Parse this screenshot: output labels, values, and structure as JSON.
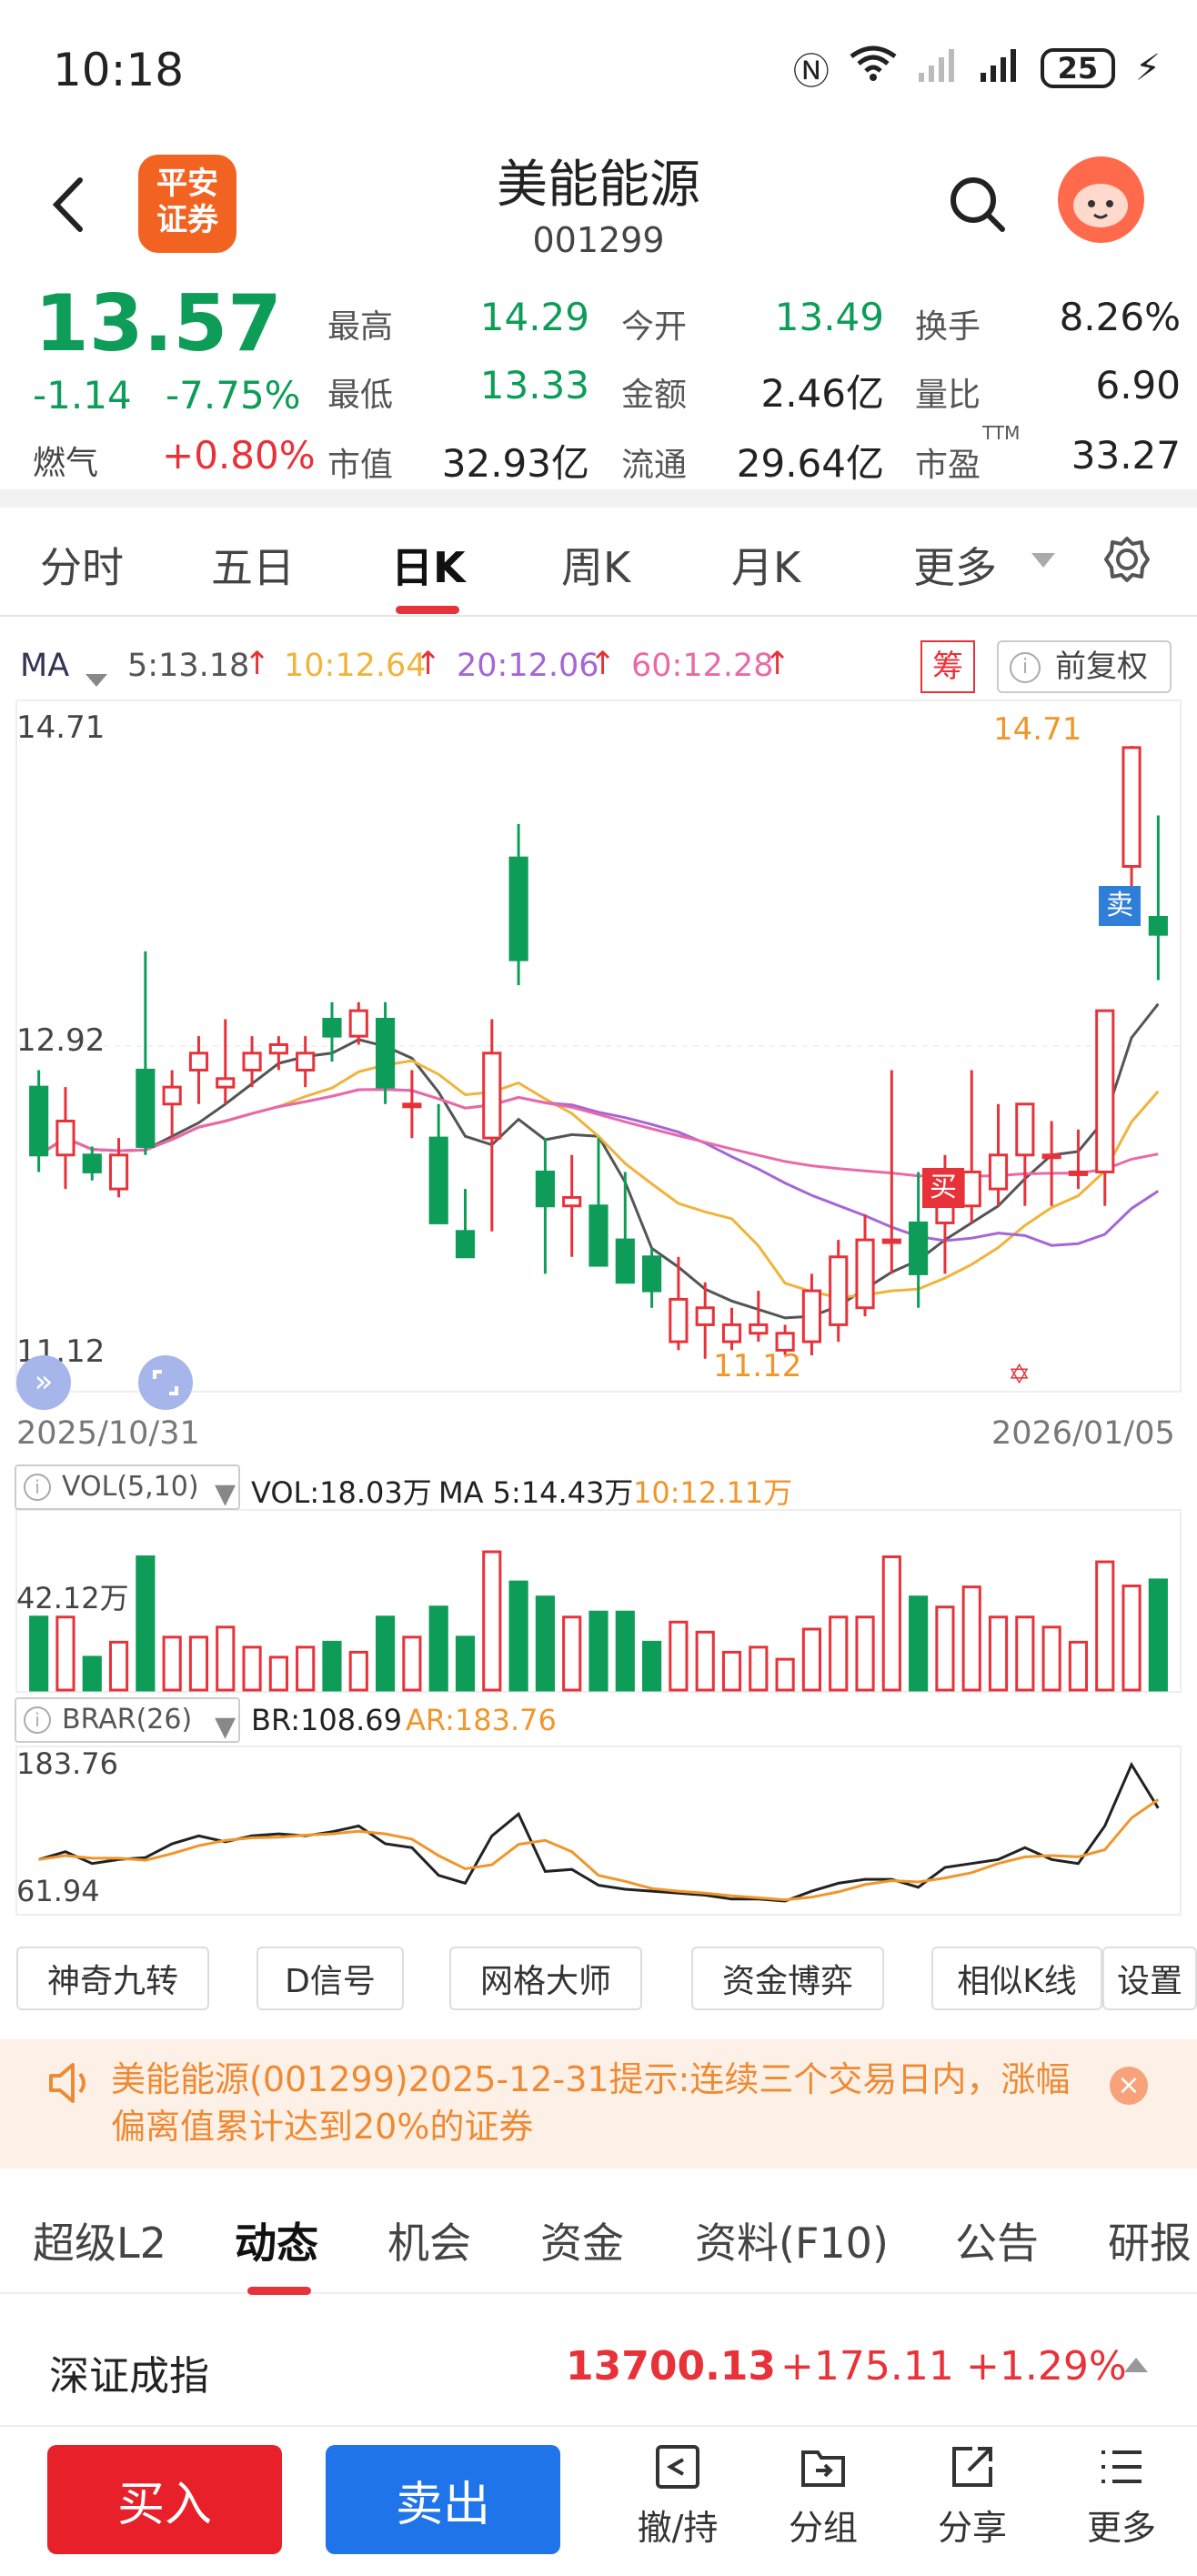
{
  "status_bar": {
    "time": "10:18",
    "battery": "25"
  },
  "header": {
    "logo_text": "平安\n证券",
    "name": "美能能源",
    "code": "001299"
  },
  "quote": {
    "price": "13.57",
    "change": "-1.14",
    "change_pct": "-7.75%",
    "sector_name": "燃气",
    "sector_change": "+0.80%",
    "high_label": "最高",
    "high": "14.29",
    "low_label": "最低",
    "low": "13.33",
    "cap_label": "市值",
    "cap": "32.93亿",
    "open_label": "今开",
    "open": "13.49",
    "amount_label": "金额",
    "amount": "2.46亿",
    "float_label": "流通",
    "float": "29.64亿",
    "turnover_label": "换手",
    "turnover": "8.26%",
    "vol_ratio_label": "量比",
    "vol_ratio": "6.90",
    "pe_label": "市盈",
    "pe_sup": "TTM",
    "pe": "33.27"
  },
  "period_tabs": [
    "分时",
    "五日",
    "日K",
    "周K",
    "月K",
    "更多"
  ],
  "ma": {
    "label": "MA",
    "ma5": "5:13.18",
    "ma10": "10:12.64",
    "ma20": "20:12.06",
    "ma60": "60:12.28",
    "chip_label": "筹",
    "adjust_label": "前复权"
  },
  "chart_labels": {
    "price_high": "14.71",
    "price_mid": "12.92",
    "price_low": "11.12",
    "max_marker": "14.71",
    "min_marker": "11.12",
    "date_start": "2025/10/31",
    "date_end": "2026/01/05",
    "sell_marker": "卖",
    "buy_marker": "买",
    "vol_indicator": "VOL(5,10)",
    "vol_value": "VOL:18.03万",
    "vol_ma5": "MA 5:14.43万",
    "vol_ma10": "10:12.11万",
    "vol_axis": "42.12万",
    "brar_indicator": "BRAR(26)",
    "br_value": "BR:108.69",
    "ar_value": "AR:183.76",
    "brar_top": "183.76",
    "brar_bottom": "61.94"
  },
  "colors": {
    "up": "#e8323a",
    "down": "#0e9d58",
    "ma5": "#555555",
    "ma10": "#f0b43a",
    "ma20": "#a566d6",
    "ma60": "#e86aa8",
    "vol_ma10": "#f0962a"
  },
  "chart_data": {
    "type": "candlestick",
    "x": [
      "2025/10/31",
      "2026/01/05"
    ],
    "ohlc": [
      [
        12.7,
        12.8,
        12.2,
        12.3
      ],
      [
        12.3,
        12.7,
        12.1,
        12.5
      ],
      [
        12.3,
        12.35,
        12.15,
        12.2
      ],
      [
        12.1,
        12.4,
        12.05,
        12.3
      ],
      [
        12.8,
        13.5,
        12.3,
        12.35
      ],
      [
        12.6,
        12.8,
        12.4,
        12.7
      ],
      [
        12.8,
        13.0,
        12.6,
        12.9
      ],
      [
        12.7,
        13.1,
        12.6,
        12.75
      ],
      [
        12.8,
        13.0,
        12.7,
        12.9
      ],
      [
        12.9,
        13.0,
        12.8,
        12.95
      ],
      [
        12.8,
        13.0,
        12.7,
        12.9
      ],
      [
        13.1,
        13.2,
        12.85,
        13.0
      ],
      [
        13.0,
        13.2,
        12.95,
        13.15
      ],
      [
        13.1,
        13.2,
        12.6,
        12.7
      ],
      [
        12.6,
        12.8,
        12.4,
        12.6
      ],
      [
        12.4,
        12.6,
        11.9,
        11.9
      ],
      [
        11.85,
        12.1,
        11.7,
        11.7
      ],
      [
        12.4,
        13.1,
        11.85,
        12.9
      ],
      [
        14.05,
        14.25,
        13.3,
        13.45
      ],
      [
        12.2,
        12.4,
        11.6,
        12.0
      ],
      [
        12.0,
        12.3,
        11.7,
        12.05
      ],
      [
        12.0,
        12.4,
        11.75,
        11.65
      ],
      [
        11.8,
        12.2,
        11.55,
        11.55
      ],
      [
        11.7,
        11.75,
        11.4,
        11.5
      ],
      [
        11.2,
        11.7,
        11.15,
        11.45
      ],
      [
        11.3,
        11.55,
        11.1,
        11.4
      ],
      [
        11.2,
        11.4,
        11.15,
        11.3
      ],
      [
        11.25,
        11.5,
        11.2,
        11.3
      ],
      [
        11.15,
        11.3,
        11.12,
        11.25
      ],
      [
        11.2,
        11.6,
        11.12,
        11.5
      ],
      [
        11.3,
        11.8,
        11.2,
        11.7
      ],
      [
        11.4,
        11.95,
        11.35,
        11.8
      ],
      [
        11.8,
        12.8,
        11.6,
        11.8
      ],
      [
        11.9,
        12.2,
        11.4,
        11.6
      ],
      [
        11.9,
        12.3,
        11.6,
        12.1
      ],
      [
        12.0,
        12.8,
        11.9,
        12.2
      ],
      [
        12.1,
        12.6,
        12.0,
        12.3
      ],
      [
        12.3,
        12.6,
        12.0,
        12.6
      ],
      [
        12.3,
        12.5,
        12.0,
        12.3
      ],
      [
        12.2,
        12.45,
        12.1,
        12.2
      ],
      [
        12.2,
        13.15,
        12.0,
        13.15
      ],
      [
        14.0,
        14.71,
        13.8,
        14.7
      ],
      [
        13.7,
        14.3,
        13.33,
        13.6
      ]
    ],
    "volume_max": "42.12万",
    "price_range": [
      11.12,
      14.71
    ]
  },
  "tools": [
    "神奇九转",
    "D信号",
    "网格大师",
    "资金博弈",
    "相似K线",
    "设置"
  ],
  "notice": {
    "text": "美能能源(001299)2025-12-31提示:连续三个交易日内，涨幅偏离值累计达到20%的证券"
  },
  "info_tabs": [
    "超级L2",
    "动态",
    "机会",
    "资金",
    "资料(F10)",
    "公告",
    "研报"
  ],
  "index": {
    "name": "深证成指",
    "value": "13700.13",
    "change": "+175.11",
    "change_pct": "+1.29%"
  },
  "bottom": {
    "buy": "买入",
    "sell": "卖出",
    "nav": [
      "撤/持",
      "分组",
      "分享",
      "更多"
    ]
  }
}
